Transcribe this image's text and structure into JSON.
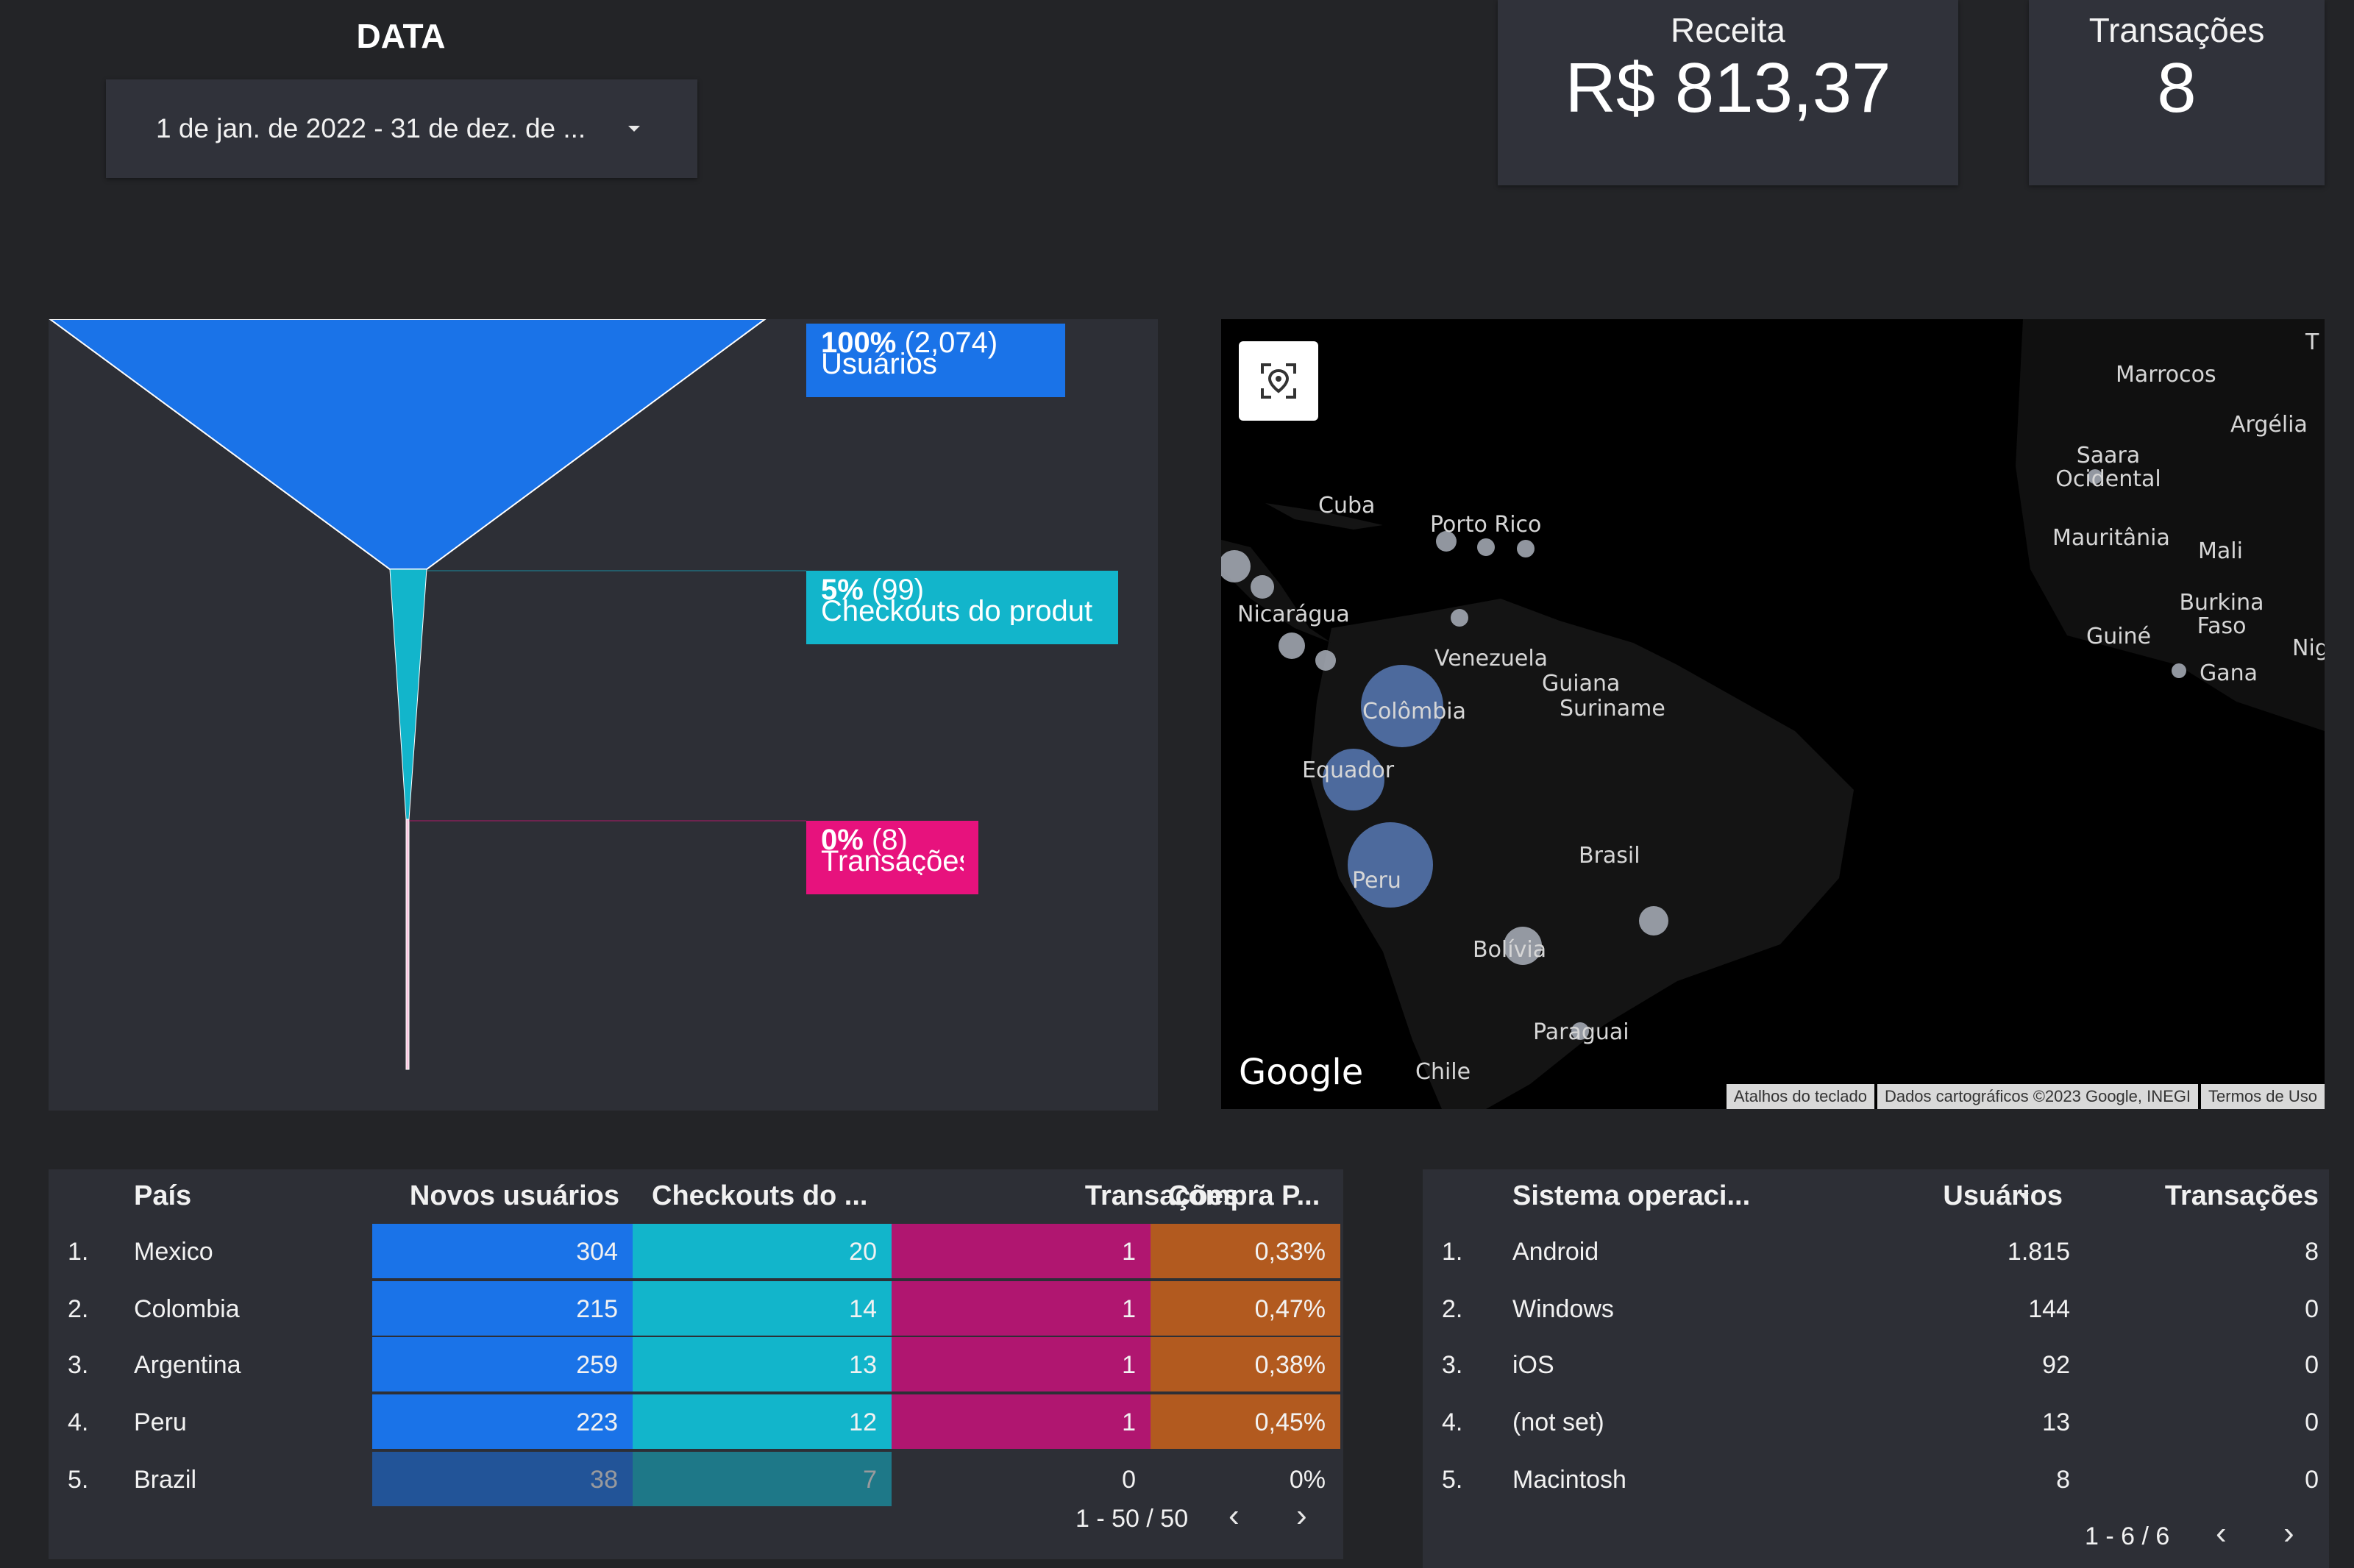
{
  "date_filter": {
    "title": "DATA",
    "value": "1 de jan. de 2022 - 31 de dez. de ..."
  },
  "scorecards": [
    {
      "label": "Receita",
      "value": "R$ 813,37"
    },
    {
      "label": "Transações",
      "value": "8"
    }
  ],
  "funnel": {
    "stages": [
      {
        "pct": "100%",
        "count": "(2,074)",
        "name": "Usuários",
        "color": "#1a73e8",
        "value": 2074
      },
      {
        "pct": "5%",
        "count": "(99)",
        "name": "Checkouts do produt",
        "color": "#12b5cb",
        "value": 99
      },
      {
        "pct": "0%",
        "count": "(8)",
        "name": "Transações",
        "color": "#e7127d",
        "value": 8
      }
    ]
  },
  "map": {
    "labels": [
      "Marrocos",
      "Argélia",
      "Saara Ocidental",
      "Mauritânia",
      "Mali",
      "Burkina Faso",
      "Guiné",
      "Gana",
      "Nig",
      "Cuba",
      "Porto Rico",
      "Nicarágua",
      "Venezuela",
      "Guiana",
      "Suriname",
      "Colômbia",
      "Equador",
      "Brasil",
      "Peru",
      "Bolívia",
      "Paraguai",
      "Chile",
      "T"
    ],
    "google": "Google",
    "attribution": [
      "Atalhos do teclado",
      "Dados cartográficos ©2023 Google, INEGI",
      "Termos de Uso"
    ],
    "location_icon": "location-target-icon"
  },
  "country_table": {
    "headers": [
      "País",
      "Novos usuários",
      "Checkouts do ...",
      "Transações",
      "Compra P..."
    ],
    "rows": [
      {
        "n": "1.",
        "country": "Mexico",
        "users": "304",
        "checkouts": "20",
        "trans": "1",
        "rate": "0,33%"
      },
      {
        "n": "2.",
        "country": "Colombia",
        "users": "215",
        "checkouts": "14",
        "trans": "1",
        "rate": "0,47%"
      },
      {
        "n": "3.",
        "country": "Argentina",
        "users": "259",
        "checkouts": "13",
        "trans": "1",
        "rate": "0,38%"
      },
      {
        "n": "4.",
        "country": "Peru",
        "users": "223",
        "checkouts": "12",
        "trans": "1",
        "rate": "0,45%"
      },
      {
        "n": "5.",
        "country": "Brazil",
        "users": "38",
        "checkouts": "7",
        "trans": "0",
        "rate": "0%"
      }
    ],
    "pager": "1 - 50 / 50",
    "colors": {
      "users": "#1a73e8",
      "checkouts": "#12b5cb",
      "trans": "#b01670",
      "rate": "#b25a1f"
    }
  },
  "os_table": {
    "headers": [
      "Sistema operaci...",
      "Usuários",
      "Transações"
    ],
    "sort_icon": "sort-desc-icon",
    "rows": [
      {
        "n": "1.",
        "os": "Android",
        "users": "1.815",
        "trans": "8"
      },
      {
        "n": "2.",
        "os": "Windows",
        "users": "144",
        "trans": "0"
      },
      {
        "n": "3.",
        "os": "iOS",
        "users": "92",
        "trans": "0"
      },
      {
        "n": "4.",
        "os": "(not set)",
        "users": "13",
        "trans": "0"
      },
      {
        "n": "5.",
        "os": "Macintosh",
        "users": "8",
        "trans": "0"
      }
    ],
    "pager": "1 - 6 / 6"
  }
}
